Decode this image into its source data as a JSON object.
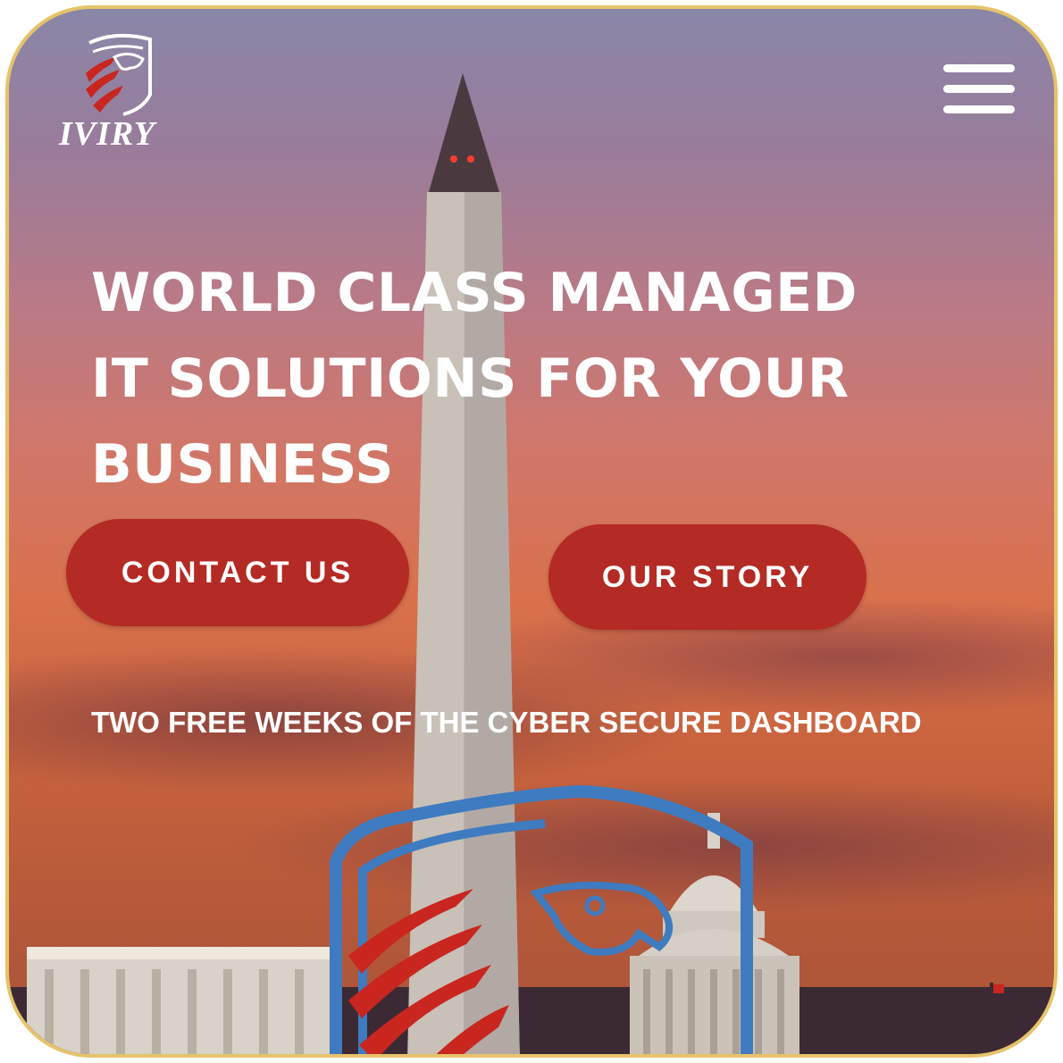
{
  "brand": {
    "name": "IVIRY",
    "logo_icon": "eagle-shield-icon"
  },
  "header": {
    "menu_icon": "hamburger-menu-icon"
  },
  "hero": {
    "title": "WORLD CLASS MANAGED\nIT SOLUTIONS FOR YOUR\nBUSINESS",
    "primary_button": "CONTACT US",
    "secondary_button": "OUR STORY",
    "subline": "TWO FREE WEEKS OF THE CYBER SECURE DASHBOARD"
  },
  "colors": {
    "frame_border": "#e6c36a",
    "button_red": "#b42a24",
    "text": "#ffffff",
    "emblem_blue": "#3f7bc0",
    "emblem_red": "#c8261f"
  }
}
